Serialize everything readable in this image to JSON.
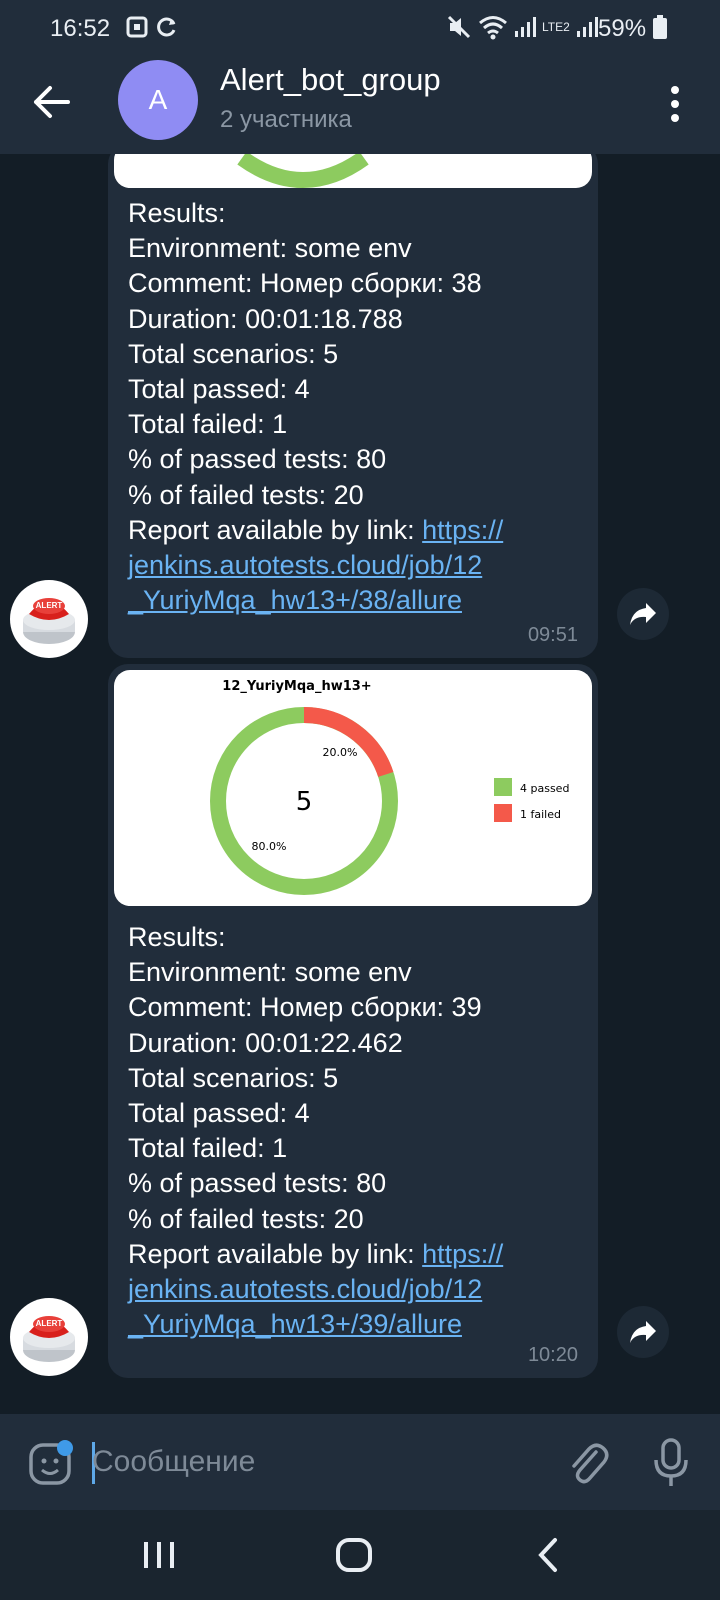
{
  "status_bar": {
    "time": "16:52",
    "battery": "59%",
    "network": "LTE2"
  },
  "header": {
    "avatar_letter": "A",
    "title": "Alert_bot_group",
    "subtitle": "2 участника"
  },
  "messages": [
    {
      "lines": [
        {
          "label": "Results:",
          "value": ""
        },
        {
          "label": "Environment:",
          "value": " some env"
        },
        {
          "label": "Comment:",
          "value": " Номер сборки: 38"
        },
        {
          "label": "Duration:",
          "value": " 00:01:18.788"
        },
        {
          "label": "Total scenarios:",
          "value": " 5"
        },
        {
          "label": "Total passed:",
          "value": " 4"
        },
        {
          "label": "Total failed:",
          "value": " 1"
        },
        {
          "label": "% of passed tests:",
          "value": " 80"
        },
        {
          "label": "% of failed tests:",
          "value": " 20"
        }
      ],
      "link_label": "Report available by link: ",
      "link_lines": [
        "https://",
        "jenkins.autotests.cloud/job/12",
        "_YuriyMqa_hw13+/38/allure"
      ],
      "time": "09:51"
    },
    {
      "lines": [
        {
          "label": "Results:",
          "value": ""
        },
        {
          "label": "Environment:",
          "value": " some env"
        },
        {
          "label": "Comment:",
          "value": " Номер сборки: 39"
        },
        {
          "label": "Duration:",
          "value": " 00:01:22.462"
        },
        {
          "label": "Total scenarios:",
          "value": " 5"
        },
        {
          "label": "Total passed:",
          "value": " 4"
        },
        {
          "label": "Total failed:",
          "value": " 1"
        },
        {
          "label": "% of passed tests:",
          "value": " 80"
        },
        {
          "label": "% of failed tests:",
          "value": " 20"
        }
      ],
      "link_label": "Report available by link: ",
      "link_lines": [
        "https://",
        "jenkins.autotests.cloud/job/12",
        "_YuriyMqa_hw13+/39/allure"
      ],
      "time": "10:20"
    }
  ],
  "chart": {
    "title": "12_YuriyMqa_hw13+",
    "center": "5",
    "pct_failed": "20.0%",
    "pct_passed": "80.0%",
    "legend_passed": "4 passed",
    "legend_failed": "1 failed",
    "passed_color": "#8dcb5f",
    "failed_color": "#f4594a"
  },
  "chart_data": {
    "type": "pie",
    "title": "12_YuriyMqa_hw13+",
    "categories": [
      "4 passed",
      "1 failed"
    ],
    "values": [
      4,
      1
    ],
    "colors": [
      "#8dcb5f",
      "#f4594a"
    ]
  },
  "avatar_badge": "ALERT",
  "composer": {
    "placeholder": "Сообщение"
  },
  "colors": {
    "accent": "#6ab3f3",
    "bubble": "#212d3b",
    "header": "#212d3b"
  }
}
